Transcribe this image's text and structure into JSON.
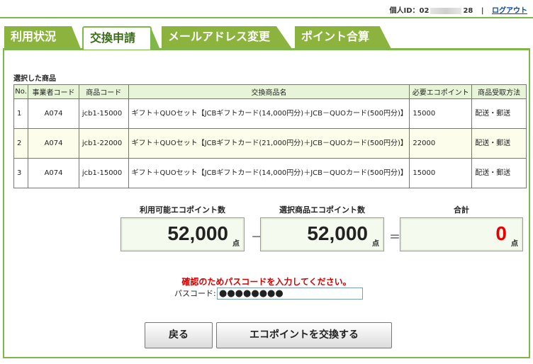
{
  "header": {
    "user_id_label": "個人ID：02",
    "user_id_suffix": "28",
    "separator": "|",
    "logout_label": "ログアウト"
  },
  "tabs": [
    {
      "label": "利用状況",
      "active": false
    },
    {
      "label": "交換申請",
      "active": true
    },
    {
      "label": "メールアドレス変更",
      "active": false
    },
    {
      "label": "ポイント合算",
      "active": false
    }
  ],
  "selected": {
    "title": "選択した商品",
    "columns": [
      "No.",
      "事業者コード",
      "商品コード",
      "交換商品名",
      "必要エコポイント",
      "商品受取方法"
    ],
    "rows": [
      {
        "no": "1",
        "vendor": "A074",
        "code": "jcb1-15000",
        "name": "ギフト＋QUOセット【JCBギフトカード(14,000円分)＋JCB－QUOカード(500円分)】",
        "points": "15000",
        "method": "配送・郵送"
      },
      {
        "no": "2",
        "vendor": "A074",
        "code": "jcb1-22000",
        "name": "ギフト＋QUOセット【JCBギフトカード(21,000円分)＋JCB－QUOカード(500円分)】",
        "points": "22000",
        "method": "配送・郵送"
      },
      {
        "no": "3",
        "vendor": "A074",
        "code": "jcb1-15000",
        "name": "ギフト＋QUOセット【JCBギフトカード(14,000円分)＋JCB－QUOカード(500円分)】",
        "points": "15000",
        "method": "配送・郵送"
      }
    ]
  },
  "points": {
    "available_label": "利用可能エコポイント数",
    "available_value": "52,000",
    "selected_label": "選択商品エコポイント数",
    "selected_value": "52,000",
    "total_label": "合計",
    "total_value": "0",
    "unit": "点",
    "minus": "－",
    "equals": "＝"
  },
  "passcode": {
    "message": "確認のためパスコードを入力してください。",
    "label": "パスコード:",
    "value": "●●●●●●●●"
  },
  "buttons": {
    "back": "戻る",
    "exchange": "エコポイントを交換する"
  },
  "colors": {
    "accent_green": "#7fb84a",
    "tab_green": "#8cb33d",
    "alert_red": "#d40000"
  }
}
